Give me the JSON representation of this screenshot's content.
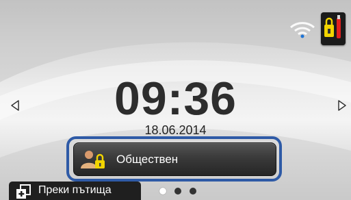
{
  "home": {
    "clock": {
      "time": "09:36",
      "date": "18.06.2014"
    },
    "profile": {
      "label": "Обществен",
      "icon": "user-lock-icon"
    },
    "shortcuts": {
      "label": "Преки пътища",
      "icon": "add-shortcut-icon"
    },
    "pagination": {
      "total": 3,
      "current": 1
    },
    "status": {
      "wifi_icon": "wifi-icon",
      "tools_icon": "settings-tools-icon"
    },
    "navigation": {
      "left_icon": "arrow-left-icon",
      "right_icon": "arrow-right-icon"
    }
  },
  "colors": {
    "focus_ring": "#2e5aa6",
    "wifi": "#1e74d6",
    "profile_button": "#333333",
    "clock_text": "#2d2d2d"
  }
}
